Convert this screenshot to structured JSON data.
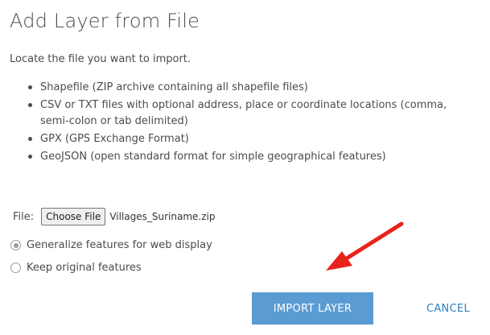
{
  "dialog": {
    "title": "Add Layer from File",
    "instruction": "Locate the file you want to import.",
    "formats": [
      "Shapefile (ZIP archive containing all shapefile files)",
      "CSV or TXT files with optional address, place or coordinate locations (comma, semi-colon or tab delimited)",
      "GPX (GPS Exchange Format)",
      "GeoJSON (open standard format for simple geographical features)"
    ],
    "file": {
      "label": "File:",
      "button_label": "Choose File",
      "selected_name": "Villages_Suriname.zip"
    },
    "options": {
      "generalize_label": "Generalize features for web display",
      "keep_label": "Keep original features",
      "selected": "generalize"
    },
    "buttons": {
      "import_label": "IMPORT LAYER",
      "cancel_label": "CANCEL"
    },
    "colors": {
      "import_bg": "#5a9bd3",
      "cancel_text": "#2e7fc0",
      "annotation_arrow": "#e8231c"
    }
  }
}
